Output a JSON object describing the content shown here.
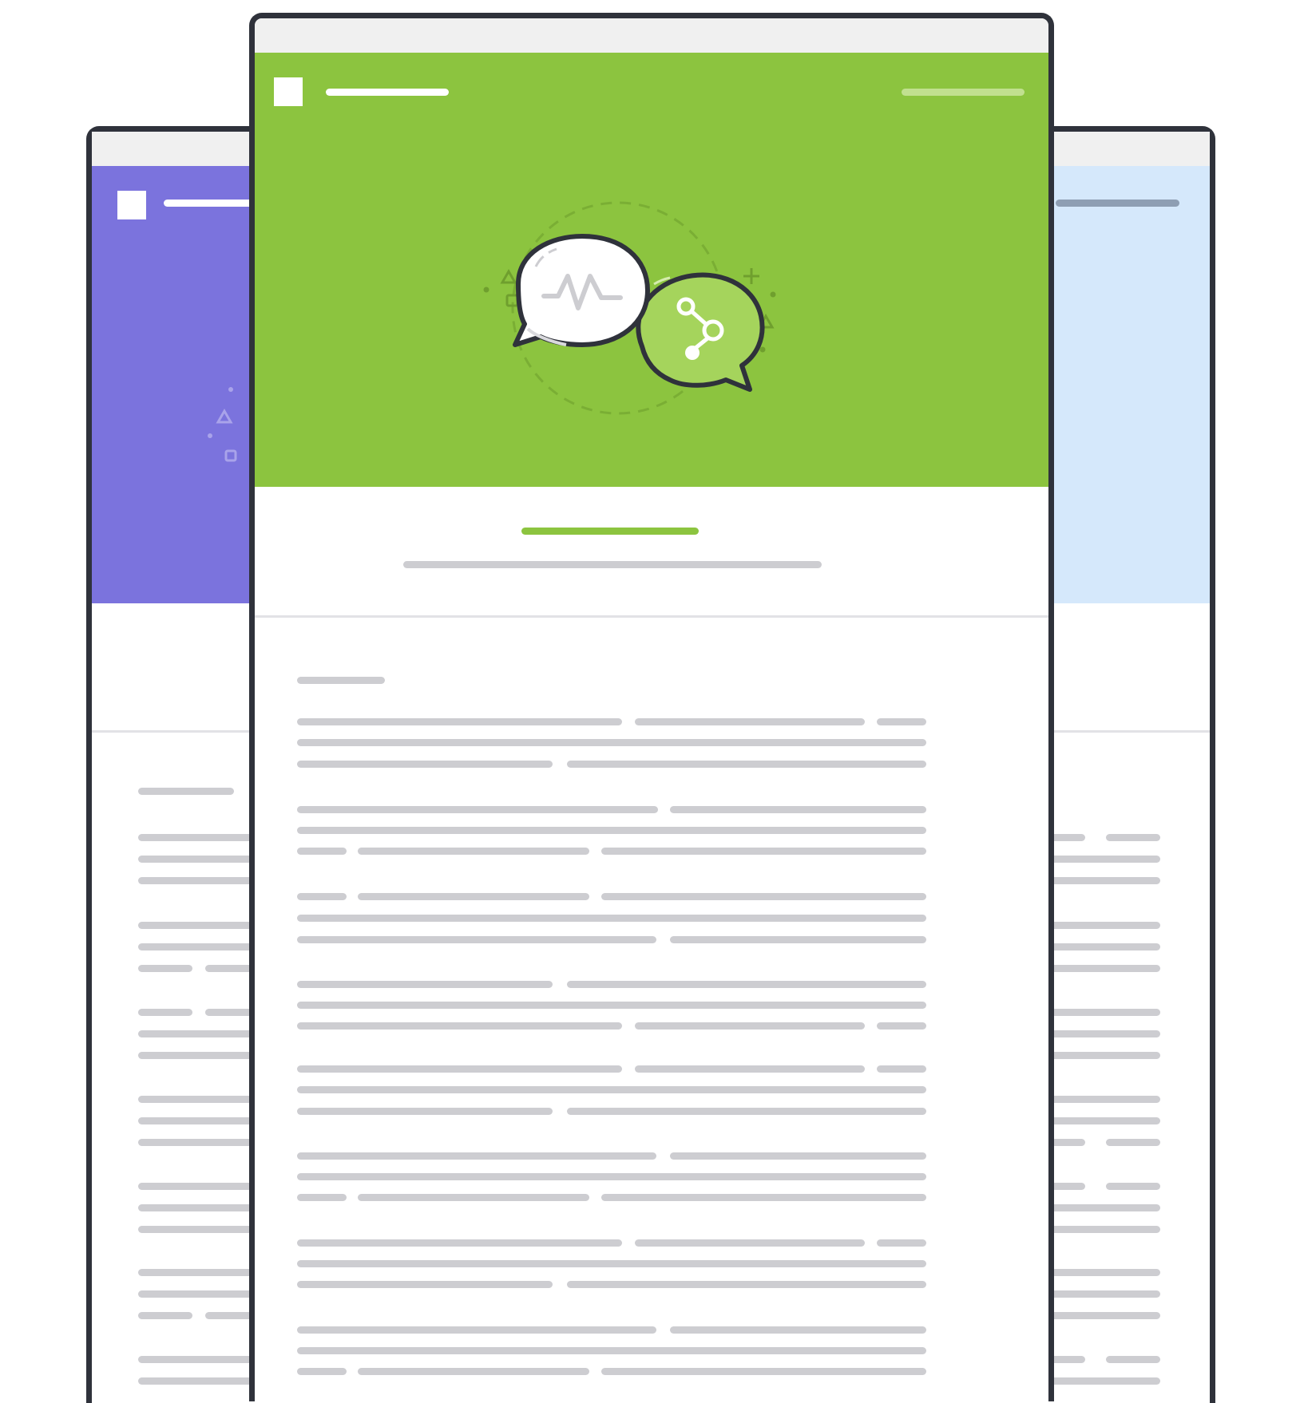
{
  "colors": {
    "frame": "#2f323b",
    "chrome": "#f0f0f0",
    "main_hero": "#8cc43f",
    "left_hero": "#7b73dd",
    "right_hero": "#d5e8fb",
    "accent_bar": "#8cc43f",
    "text_placeholder": "#cdcdd1"
  },
  "icons": {
    "logo": "square-logo-icon",
    "chat_left": "chat-bubble-activity-icon",
    "chat_right": "chat-bubble-share-icon"
  }
}
